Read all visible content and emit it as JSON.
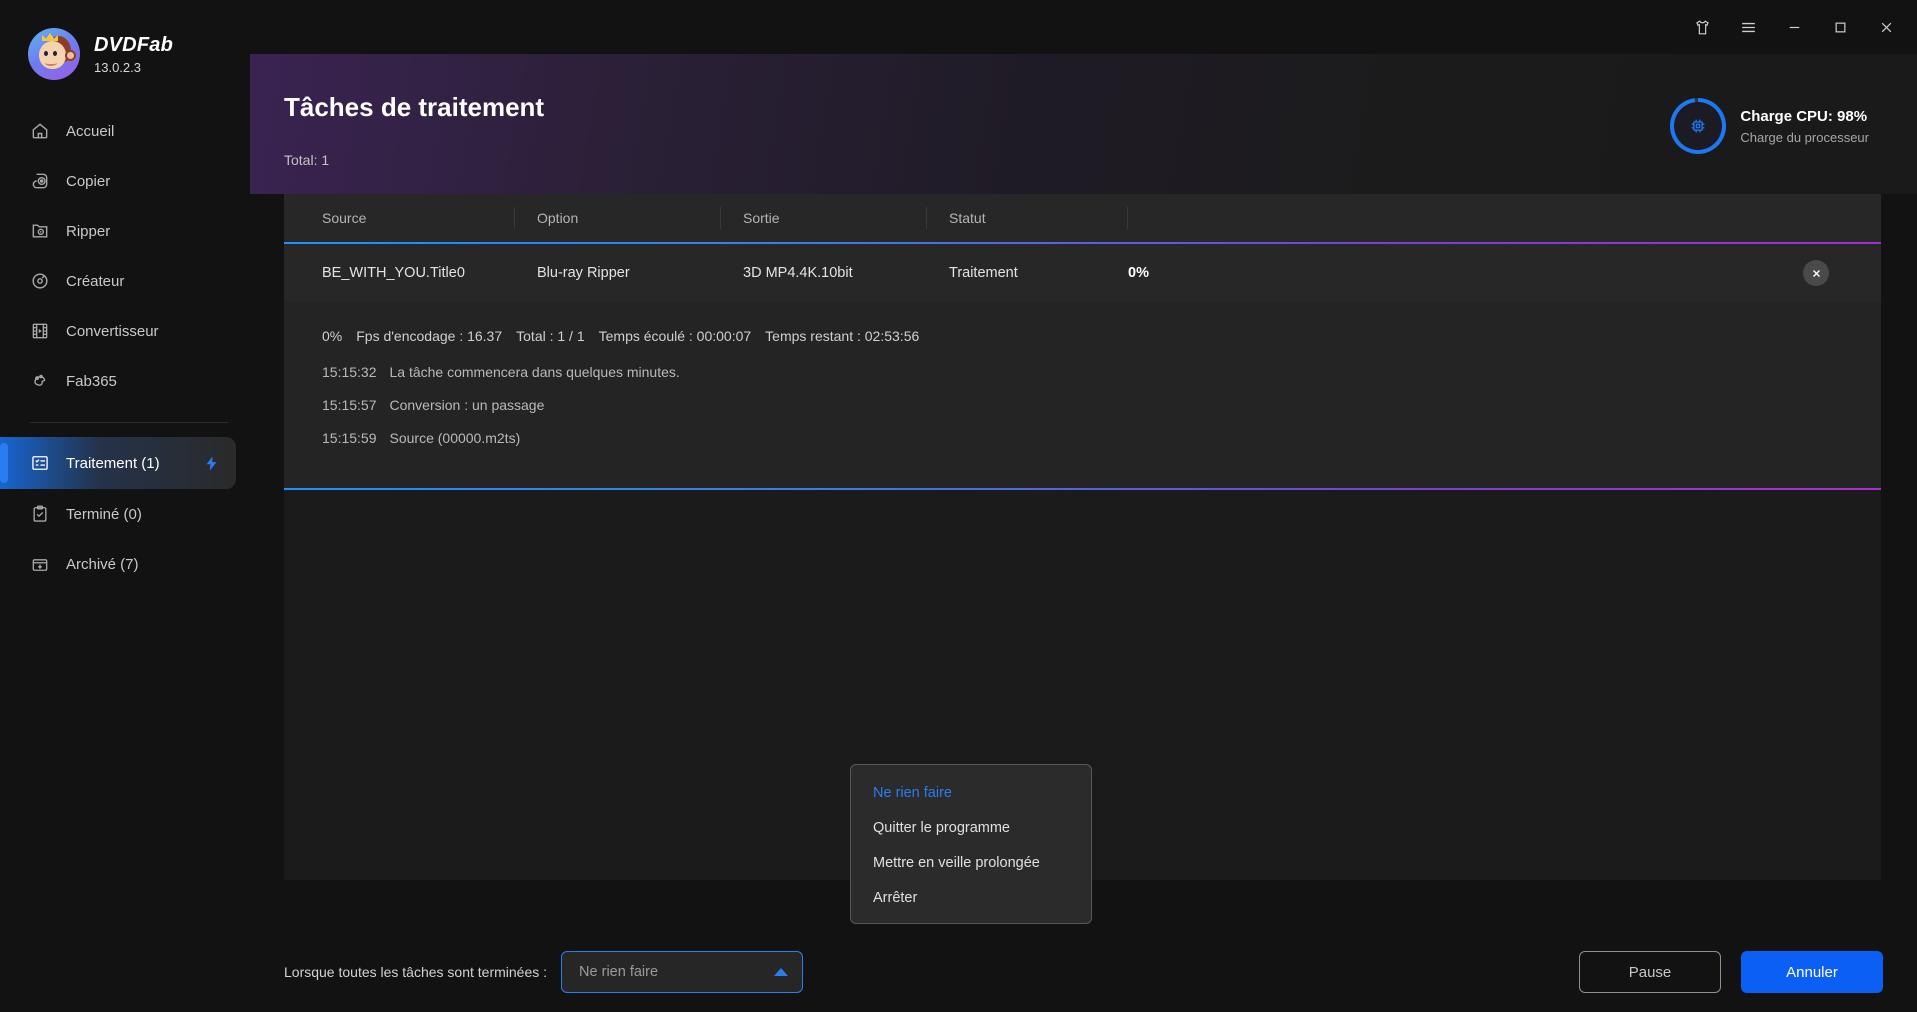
{
  "app": {
    "brand_name": "DVDFab",
    "version": "13.0.2.3",
    "accent_blue": "#2b7cf0",
    "primary_button": "#0b5ff5",
    "header_purple": "#3a2352"
  },
  "titlebar": {
    "theme_label": "theme-shirt",
    "menu_label": "menu",
    "minimize_label": "minimize",
    "maximize_label": "maximize",
    "close_label": "close"
  },
  "sidebar": {
    "items": [
      {
        "label": "Accueil",
        "icon": "home-icon",
        "active": false
      },
      {
        "label": "Copier",
        "icon": "disc-copy-icon",
        "active": false
      },
      {
        "label": "Ripper",
        "icon": "rip-folder-icon",
        "active": false
      },
      {
        "label": "Créateur",
        "icon": "disc-creator-icon",
        "active": false
      },
      {
        "label": "Convertisseur",
        "icon": "film-strip-icon",
        "active": false
      },
      {
        "label": "Fab365",
        "icon": "fab365-paw-icon",
        "active": false
      }
    ],
    "queue_items": [
      {
        "label": "Traitement (1)",
        "icon": "task-list-icon",
        "active": true,
        "badge_icon": "lightning-icon"
      },
      {
        "label": "Terminé (0)",
        "icon": "clipboard-check-icon",
        "active": false
      },
      {
        "label": "Archivé (7)",
        "icon": "archive-box-icon",
        "active": false
      }
    ]
  },
  "header": {
    "title": "Tâches de traitement",
    "total": "Total: 1",
    "cpu": {
      "main": "Charge CPU: 98%",
      "sub": "Charge du processeur",
      "percent": 98,
      "icon": "cpu-chip-icon"
    }
  },
  "table": {
    "columns": [
      "Source",
      "Option",
      "Sortie",
      "Statut"
    ],
    "rows": [
      {
        "source": "BE_WITH_YOU.Title0",
        "option": "Blu-ray Ripper",
        "sortie": "3D MP4.4K.10bit",
        "statut": "Traitement",
        "progress": "0%",
        "close_icon": "close-icon"
      }
    ]
  },
  "task_detail": {
    "stats": [
      "0%",
      "Fps d'encodage : 16.37",
      "Total : 1 / 1",
      "Temps écoulé : 00:00:07",
      "Temps restant : 02:53:56"
    ],
    "log": [
      {
        "time": "15:15:32",
        "message": "La tâche commencera dans quelques minutes."
      },
      {
        "time": "15:15:57",
        "message": "Conversion : un passage"
      },
      {
        "time": "15:15:59",
        "message": "Source (00000.m2ts)"
      }
    ]
  },
  "bottom": {
    "when_label": "Lorsque toutes les tâches sont terminées :",
    "select_value": "Ne rien faire",
    "select_arrow_icon": "chevron-up-icon",
    "options": [
      "Ne rien faire",
      "Quitter le programme",
      "Mettre en veille prolongée",
      "Arrêter"
    ],
    "selected_index": 0,
    "pause_label": "Pause",
    "cancel_label": "Annuler"
  }
}
